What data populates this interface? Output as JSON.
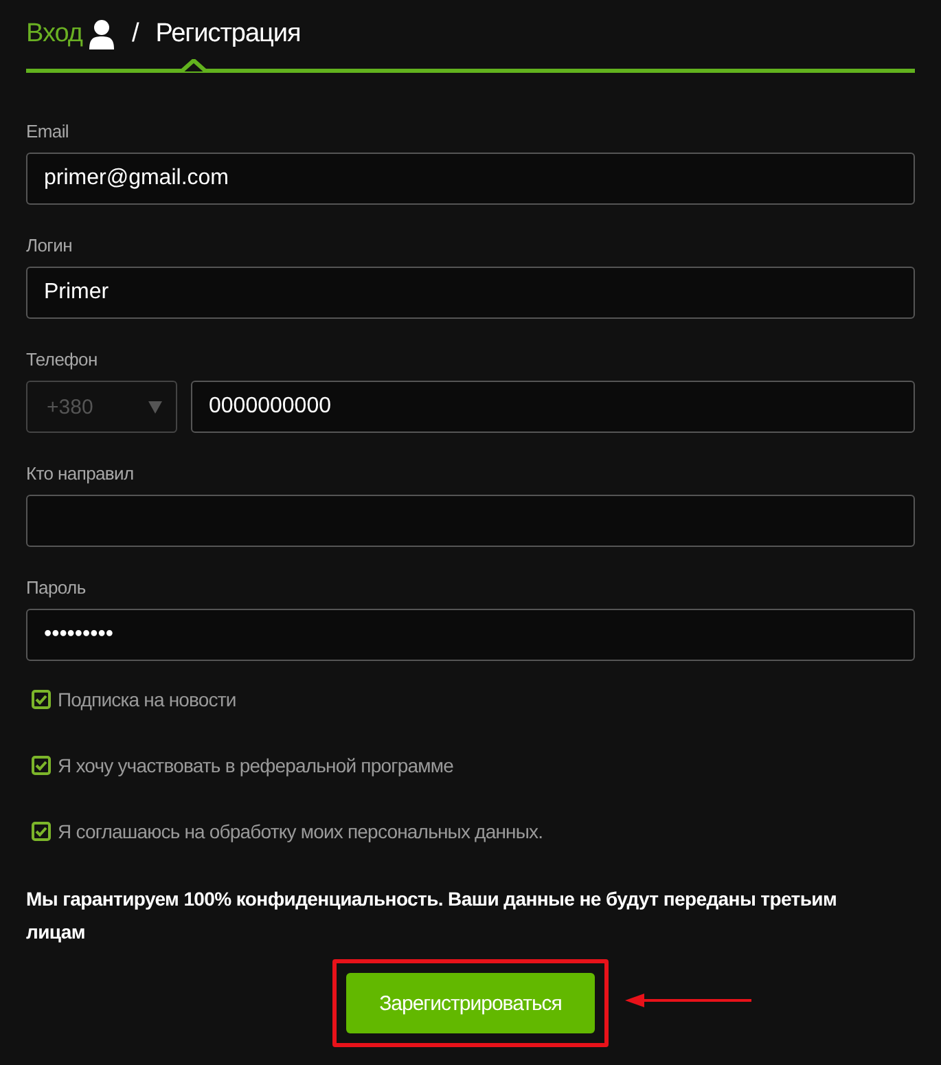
{
  "tabs": [
    {
      "label": "Вход",
      "selected": false,
      "icon": true
    },
    {
      "label": "Регистрация",
      "selected": true,
      "icon": false
    }
  ],
  "tab_separator": "/",
  "fields": [
    {
      "kind": "text",
      "label": "Email",
      "value": "primer@gmail.com"
    },
    {
      "kind": "text",
      "label": "Логин",
      "value": "Primer"
    },
    {
      "kind": "phone",
      "label": "Телефон",
      "code": "+380",
      "value": "0000000000"
    },
    {
      "kind": "text",
      "label": "Кто направил"
    },
    {
      "kind": "text",
      "label": "Пароль",
      "value": "•••••••••"
    }
  ],
  "checkboxes": [
    {
      "label": "Подписка на новости",
      "checked": true
    },
    {
      "label": "Я хочу участвовать в реферальной программе",
      "checked": true
    },
    {
      "label": "Я соглашаюсь на обработку моих персональных данных.",
      "checked": true
    }
  ],
  "notice": "Мы гарантируем 100% конфиденциальность. Ваши данные не будут переданы третьим лицам",
  "submit": {
    "label": "Зарегистрироваться",
    "highlighted": true
  }
}
